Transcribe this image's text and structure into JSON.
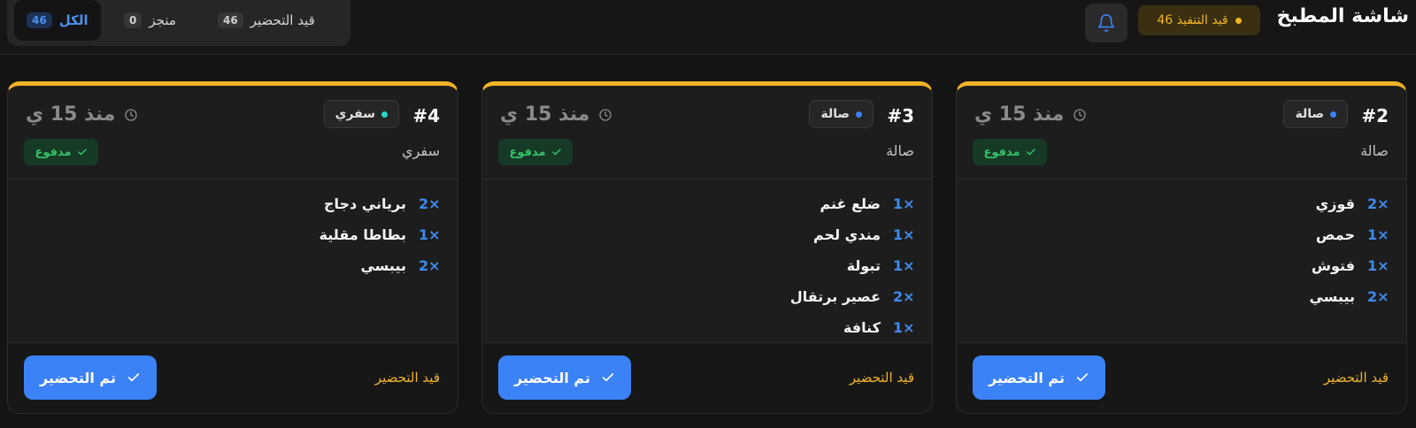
{
  "header": {
    "title": "شاشة المطبخ",
    "status_pill": "46 قيد التنفيذ",
    "status_color": "#f0b429"
  },
  "filters": [
    {
      "label": "الكل",
      "count": "46",
      "active": true
    },
    {
      "label": "منجز",
      "count": "0",
      "active": false
    },
    {
      "label": "قيد التحضير",
      "count": "46",
      "active": false
    }
  ],
  "orders": [
    {
      "number": "#2",
      "type": "صالة",
      "type_dot_color": "#3b82f6",
      "time": "منذ 15 ي",
      "subtype": "صالة",
      "paid": "مدفوع",
      "items": [
        {
          "qty": "2×",
          "name": "قوزي"
        },
        {
          "qty": "1×",
          "name": "حمص"
        },
        {
          "qty": "1×",
          "name": "فتوش"
        },
        {
          "qty": "2×",
          "name": "بيبسي"
        }
      ],
      "footer_status": "قيد التحضير",
      "action": "تم التحضير"
    },
    {
      "number": "#3",
      "type": "صالة",
      "type_dot_color": "#3b82f6",
      "time": "منذ 15 ي",
      "subtype": "صالة",
      "paid": "مدفوع",
      "items": [
        {
          "qty": "1×",
          "name": "ضلع غنم"
        },
        {
          "qty": "1×",
          "name": "مندي لحم"
        },
        {
          "qty": "1×",
          "name": "تبولة"
        },
        {
          "qty": "2×",
          "name": "عصير برتقال"
        },
        {
          "qty": "1×",
          "name": "كنافة"
        }
      ],
      "footer_status": "قيد التحضير",
      "action": "تم التحضير"
    },
    {
      "number": "#4",
      "type": "سفري",
      "type_dot_color": "#2dd4bf",
      "time": "منذ 15 ي",
      "subtype": "سفري",
      "paid": "مدفوع",
      "items": [
        {
          "qty": "2×",
          "name": "برياني دجاج"
        },
        {
          "qty": "1×",
          "name": "بطاطا مقلية"
        },
        {
          "qty": "2×",
          "name": "بيبسي"
        }
      ],
      "footer_status": "قيد التحضير",
      "action": "تم التحضير"
    }
  ]
}
